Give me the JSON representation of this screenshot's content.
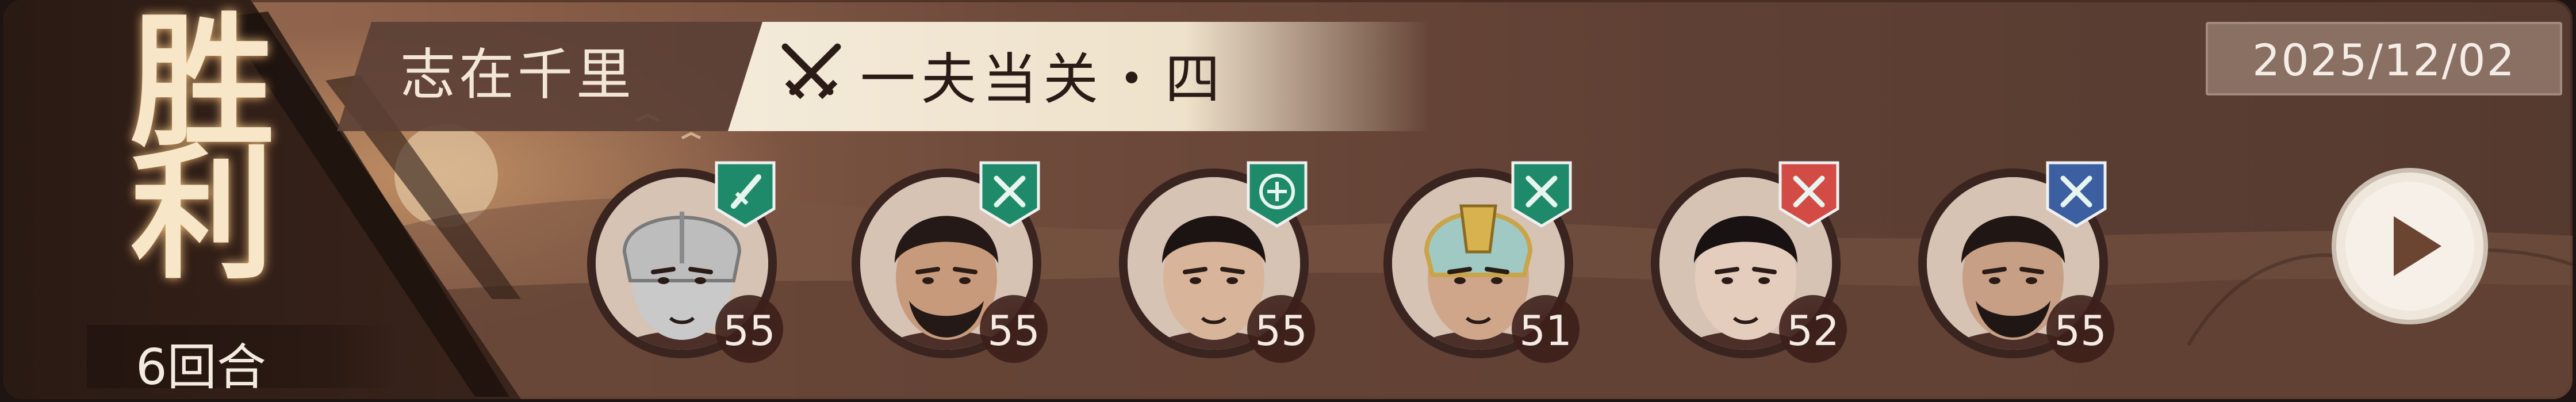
{
  "victory": {
    "label": "胜利",
    "rounds": "6回合"
  },
  "title": {
    "left": "志在千里",
    "right": "一夫当关・四"
  },
  "date": "2025/12/02",
  "heroes": [
    {
      "level": "55",
      "badge_color": "#1f8a6a",
      "badge_icon": "sword-icon",
      "skin": "#c9c9c9",
      "hair": "#8c8c8c",
      "helmet": "silver-helmet"
    },
    {
      "level": "55",
      "badge_color": "#1f8a6a",
      "badge_icon": "crossed-swords-icon",
      "skin": "#c89a7c",
      "hair": "#241916",
      "helmet": "none"
    },
    {
      "level": "55",
      "badge_color": "#1f8a6a",
      "badge_icon": "shield-plus-icon",
      "skin": "#d8b59a",
      "hair": "#1c1412",
      "helmet": "none"
    },
    {
      "level": "51",
      "badge_color": "#1f8a6a",
      "badge_icon": "crossed-swords-icon",
      "skin": "#cfa68a",
      "hair": "#3c2a22",
      "helmet": "gold-helmet"
    },
    {
      "level": "52",
      "badge_color": "#d24b45",
      "badge_icon": "crossed-swords-icon",
      "skin": "#e4cdbd",
      "hair": "#181212",
      "helmet": "none"
    },
    {
      "level": "55",
      "badge_color": "#3b5fa0",
      "badge_icon": "crossed-swords-icon",
      "skin": "#c79f85",
      "hair": "#201614",
      "helmet": "none"
    }
  ]
}
